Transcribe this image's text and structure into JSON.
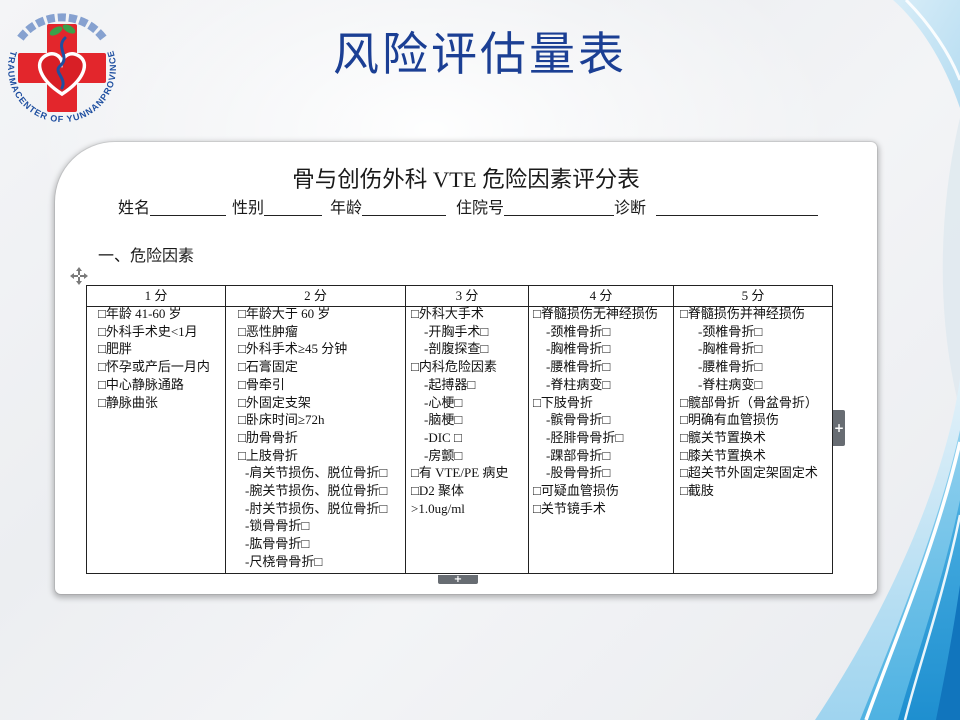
{
  "slide": {
    "title": "风险评估量表"
  },
  "logo": {
    "ring_text_en": "TRAUMACENTER OF YUNNANPROVINCE"
  },
  "document": {
    "title": "骨与创伤外科 VTE 危险因素评分表",
    "fields": [
      "姓名",
      "性别",
      "年龄",
      "住院号",
      "诊断"
    ],
    "section": "一、危险因素",
    "table": {
      "headers": [
        "1 分",
        "2 分",
        "3 分",
        "4 分",
        "5 分"
      ],
      "columns": [
        [
          "□年龄 41-60 岁",
          "□外科手术史<1月",
          "□肥胖",
          "□怀孕或产后一月内",
          "□中心静脉通路",
          "□静脉曲张"
        ],
        [
          "□年龄大于 60 岁",
          "□恶性肿瘤",
          "□外科手术≥45 分钟",
          "□石膏固定",
          "□骨牵引",
          "□外固定支架",
          "□卧床时间≥72h",
          "□肋骨骨折",
          "□上肢骨折",
          "-肩关节损伤、脱位骨折□",
          "-腕关节损伤、脱位骨折□",
          "-肘关节损伤、脱位骨折□",
          "-锁骨骨折□",
          "-肱骨骨折□",
          "-尺桡骨骨折□"
        ],
        [
          "□外科大手术",
          "-开胸手术□",
          "-剖腹探查□",
          "□内科危险因素",
          "-起搏器□",
          "-心梗□",
          "-脑梗□",
          "-DIC □",
          "-房颤□",
          "□有 VTE/PE 病史",
          "□D2 聚体",
          ">1.0ug/ml"
        ],
        [
          "□脊髓损伤无神经损伤",
          "-颈椎骨折□",
          "-胸椎骨折□",
          "-腰椎骨折□",
          "-脊柱病变□",
          "□下肢骨折",
          "-髌骨骨折□",
          "-胫腓骨骨折□",
          "-踝部骨折□",
          "-股骨骨折□",
          "□可疑血管损伤",
          "□关节镜手术"
        ],
        [
          "□脊髓损伤并神经损伤",
          "-颈椎骨折□",
          "-胸椎骨折□",
          "-腰椎骨折□",
          "-脊柱病变□",
          "□髋部骨折（骨盆骨折）",
          "□明确有血管损伤",
          "□髋关节置换术",
          "□膝关节置换术",
          "□超关节外固定架固定术",
          "□截肢"
        ]
      ]
    }
  },
  "controls": {
    "expand_right": "+",
    "expand_bottom": "+"
  },
  "icons": {
    "move": "move-arrows-icon",
    "expand": "plus-icon",
    "logo": "red-cross-heart-logo"
  },
  "colors": {
    "title": "#1b3f94",
    "logo_red": "#e3262c",
    "logo_blue": "#1f4fa0",
    "wave_light": "#9fd4ef",
    "wave_mid": "#4fb2e2",
    "wave_dark": "#1175bd",
    "handle_gray": "#676c72"
  }
}
